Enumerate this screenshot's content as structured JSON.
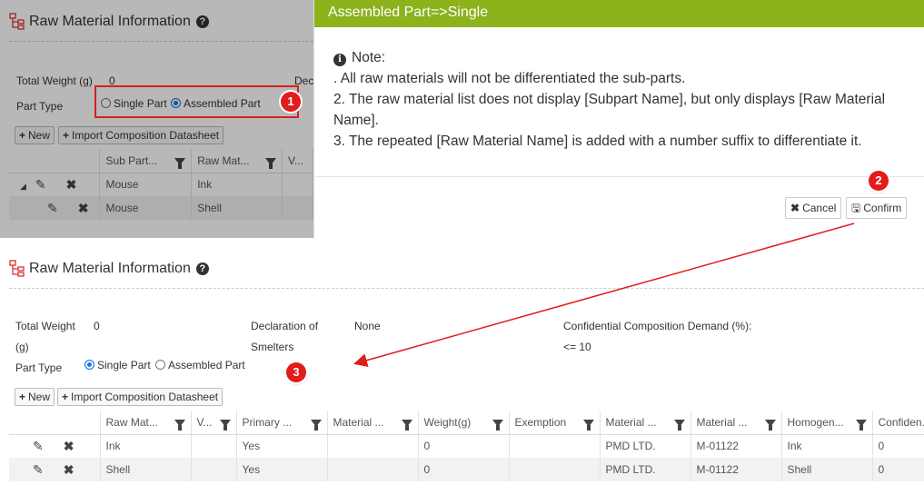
{
  "section": {
    "title": "Raw Material Information",
    "total_weight_label": "Total Weight (g)",
    "total_weight_label_line1": "Total Weight",
    "total_weight_label_line2": "(g)",
    "total_weight_value": "0",
    "declaration_label_line1": "Declaration of",
    "declaration_label_line2": "Smelters",
    "declaration_label_cut": "Dec",
    "declaration_value": "None",
    "confidential_label": "Confidential Composition Demand (%):",
    "confidential_value": "<= 10",
    "part_type_label": "Part Type",
    "single_part": "Single Part",
    "assembled_part": "Assembled Part"
  },
  "toolbar": {
    "new_label": "New",
    "import_label": "Import Composition Datasheet"
  },
  "top_grid": {
    "columns": [
      "Sub Part...",
      "Raw Mat...",
      "V..."
    ],
    "rows": [
      {
        "sub_part": "Mouse",
        "raw_material": "Ink"
      },
      {
        "sub_part": "Mouse",
        "raw_material": "Shell"
      }
    ]
  },
  "modal": {
    "title": "Assembled Part=>Single",
    "note_label": "Note:",
    "line1": ". All raw materials will not be differentiated the sub-parts.",
    "line2": "2. The raw material list does not display [Subpart Name], but only displays [Raw Material Name].",
    "line3": "3. The repeated [Raw Material Name] is added with a number suffix to differentiate it.",
    "cancel_label": "Cancel",
    "confirm_label": "Confirm"
  },
  "bottom_grid": {
    "columns": [
      "Raw Mat...",
      "V...",
      "Primary ...",
      "Material ...",
      "Weight(g)",
      "Exemption",
      "Material ...",
      "Material ...",
      "Homogen...",
      "Confiden..."
    ],
    "rows": [
      {
        "raw": "Ink",
        "v": "",
        "primary": "Yes",
        "material": "",
        "weight": "0",
        "exemption": "",
        "supplier": "PMD LTD.",
        "material_id": "M-01122",
        "homogen": "Ink",
        "confiden": "0"
      },
      {
        "raw": "Shell",
        "v": "",
        "primary": "Yes",
        "material": "",
        "weight": "0",
        "exemption": "",
        "supplier": "PMD LTD.",
        "material_id": "M-01122",
        "homogen": "Shell",
        "confiden": "0"
      }
    ]
  },
  "badges": [
    "1",
    "2",
    "3"
  ],
  "colors": {
    "modal_header": "#8cb21c",
    "highlight": "#d62020",
    "link": "#2a6ebb"
  }
}
